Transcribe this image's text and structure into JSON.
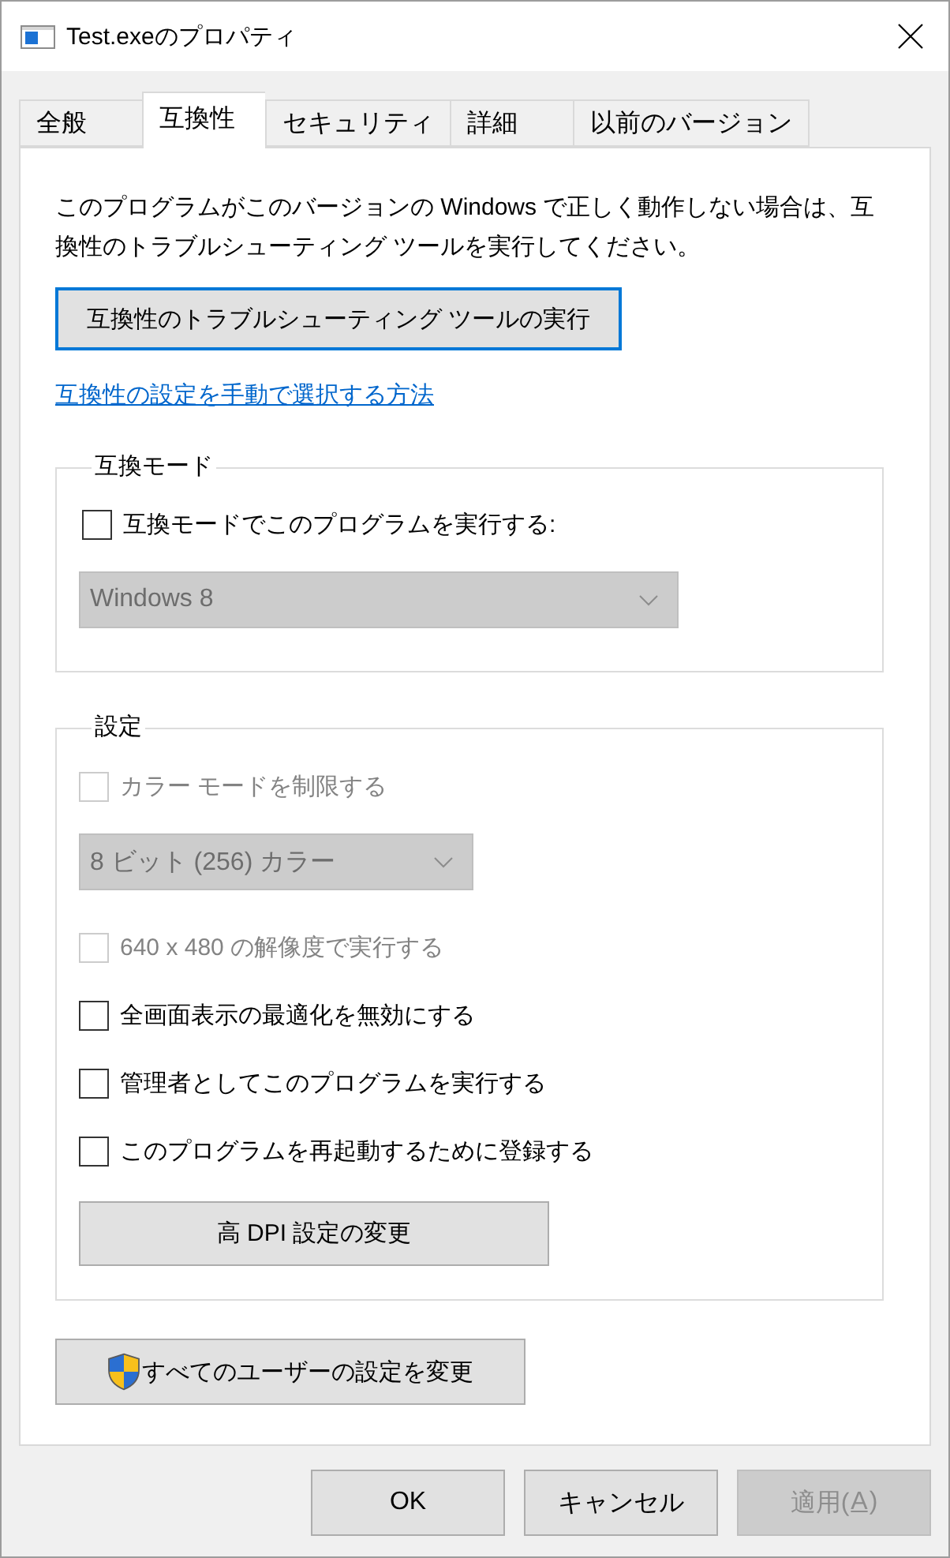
{
  "window": {
    "title": "Test.exeのプロパティ"
  },
  "tabs": [
    {
      "label": "全般",
      "selected": false
    },
    {
      "label": "互換性",
      "selected": true
    },
    {
      "label": "セキュリティ",
      "selected": false
    },
    {
      "label": "詳細",
      "selected": false
    },
    {
      "label": "以前のバージョン",
      "selected": false
    }
  ],
  "description": "このプログラムがこのバージョンの Windows で正しく動作しない場合は、互換性のトラブルシューティング ツールを実行してください。",
  "troubleshoot_button": {
    "label": "互換性のトラブルシューティング ツールの実行",
    "focused": true
  },
  "help_link": "互換性の設定を手動で選択する方法",
  "compat_mode": {
    "title": "互換モード",
    "items": [
      {
        "kind": "checkbox",
        "label": "互換モードでこのプログラムを実行する:",
        "checked": false,
        "disabled": false
      },
      {
        "kind": "select",
        "value": "Windows 8",
        "disabled": true
      }
    ]
  },
  "settings": {
    "title": "設定",
    "items": [
      {
        "kind": "checkbox",
        "label": "カラー モードを制限する",
        "checked": false,
        "disabled": true
      },
      {
        "kind": "select",
        "value": "8 ビット (256) カラー",
        "disabled": true
      },
      {
        "kind": "checkbox",
        "label": "640 x 480 の解像度で実行する",
        "checked": false,
        "disabled": true
      },
      {
        "kind": "checkbox",
        "label": "全画面表示の最適化を無効にする",
        "checked": false,
        "disabled": false
      },
      {
        "kind": "checkbox",
        "label": "管理者としてこのプログラムを実行する",
        "checked": false,
        "disabled": false
      },
      {
        "kind": "checkbox",
        "label": "このプログラムを再起動するために登録する",
        "checked": false,
        "disabled": false
      },
      {
        "kind": "button",
        "label": "高 DPI 設定の変更",
        "disabled": false
      }
    ]
  },
  "all_users_button": {
    "label": "すべてのユーザーの設定を変更"
  },
  "dialog_buttons": [
    {
      "label": "OK",
      "disabled": false
    },
    {
      "label": "キャンセル",
      "disabled": false
    },
    {
      "label": "適用(",
      "access_key": "A",
      "label_after": ")",
      "disabled": true
    }
  ]
}
